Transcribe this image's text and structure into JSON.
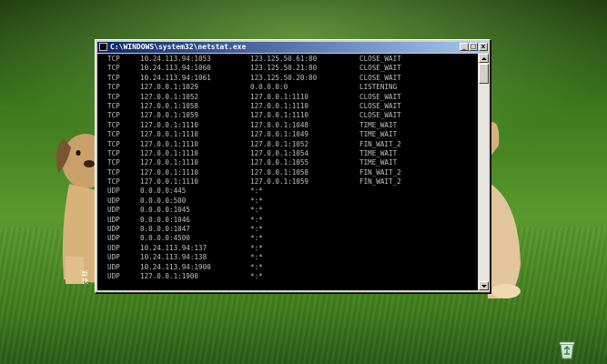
{
  "window": {
    "title": "C:\\WINDOWS\\system32\\netstat.exe",
    "minimize_label": "_",
    "maximize_label": "□",
    "close_label": "x"
  },
  "desktop": {
    "partial_label": "新\n快"
  },
  "connections": [
    {
      "proto": "TCP",
      "local": "10.24.113.94:1053",
      "foreign": "123.125.50.61:80",
      "state": "CLOSE_WAIT"
    },
    {
      "proto": "TCP",
      "local": "10.24.113.94:1060",
      "foreign": "123.125.50.21:80",
      "state": "CLOSE_WAIT"
    },
    {
      "proto": "TCP",
      "local": "10.24.113.94:1061",
      "foreign": "123.125.50.20:80",
      "state": "CLOSE_WAIT"
    },
    {
      "proto": "TCP",
      "local": "127.0.0.1:1029",
      "foreign": "0.0.0.0:0",
      "state": "LISTENING"
    },
    {
      "proto": "TCP",
      "local": "127.0.0.1:1052",
      "foreign": "127.0.0.1:1110",
      "state": "CLOSE_WAIT"
    },
    {
      "proto": "TCP",
      "local": "127.0.0.1:1058",
      "foreign": "127.0.0.1:1110",
      "state": "CLOSE_WAIT"
    },
    {
      "proto": "TCP",
      "local": "127.0.0.1:1059",
      "foreign": "127.0.0.1:1110",
      "state": "CLOSE_WAIT"
    },
    {
      "proto": "TCP",
      "local": "127.0.0.1:1110",
      "foreign": "127.0.0.1:1048",
      "state": "TIME_WAIT"
    },
    {
      "proto": "TCP",
      "local": "127.0.0.1:1110",
      "foreign": "127.0.0.1:1049",
      "state": "TIME_WAIT"
    },
    {
      "proto": "TCP",
      "local": "127.0.0.1:1110",
      "foreign": "127.0.0.1:1052",
      "state": "FIN_WAIT_2"
    },
    {
      "proto": "TCP",
      "local": "127.0.0.1:1110",
      "foreign": "127.0.0.1:1054",
      "state": "TIME_WAIT"
    },
    {
      "proto": "TCP",
      "local": "127.0.0.1:1110",
      "foreign": "127.0.0.1:1055",
      "state": "TIME_WAIT"
    },
    {
      "proto": "TCP",
      "local": "127.0.0.1:1110",
      "foreign": "127.0.0.1:1058",
      "state": "FIN_WAIT_2"
    },
    {
      "proto": "TCP",
      "local": "127.0.0.1:1110",
      "foreign": "127.0.0.1:1059",
      "state": "FIN_WAIT_2"
    },
    {
      "proto": "UDP",
      "local": "0.0.0.0:445",
      "foreign": "*:*",
      "state": ""
    },
    {
      "proto": "UDP",
      "local": "0.0.0.0:500",
      "foreign": "*:*",
      "state": ""
    },
    {
      "proto": "UDP",
      "local": "0.0.0.0:1045",
      "foreign": "*:*",
      "state": ""
    },
    {
      "proto": "UDP",
      "local": "0.0.0.0:1046",
      "foreign": "*:*",
      "state": ""
    },
    {
      "proto": "UDP",
      "local": "0.0.0.0:1047",
      "foreign": "*:*",
      "state": ""
    },
    {
      "proto": "UDP",
      "local": "0.0.0.0:4500",
      "foreign": "*:*",
      "state": ""
    },
    {
      "proto": "UDP",
      "local": "10.24.113.94:137",
      "foreign": "*:*",
      "state": ""
    },
    {
      "proto": "UDP",
      "local": "10.24.113.94:138",
      "foreign": "*:*",
      "state": ""
    },
    {
      "proto": "UDP",
      "local": "10.24.113.94:1900",
      "foreign": "*:*",
      "state": ""
    },
    {
      "proto": "UDP",
      "local": "127.0.0.1:1900",
      "foreign": "*:*",
      "state": ""
    }
  ],
  "colors": {
    "console_text": "#c0c0c0",
    "console_bg": "#000000",
    "titlebar_start": "#0a246a",
    "titlebar_end": "#a6caf0"
  }
}
